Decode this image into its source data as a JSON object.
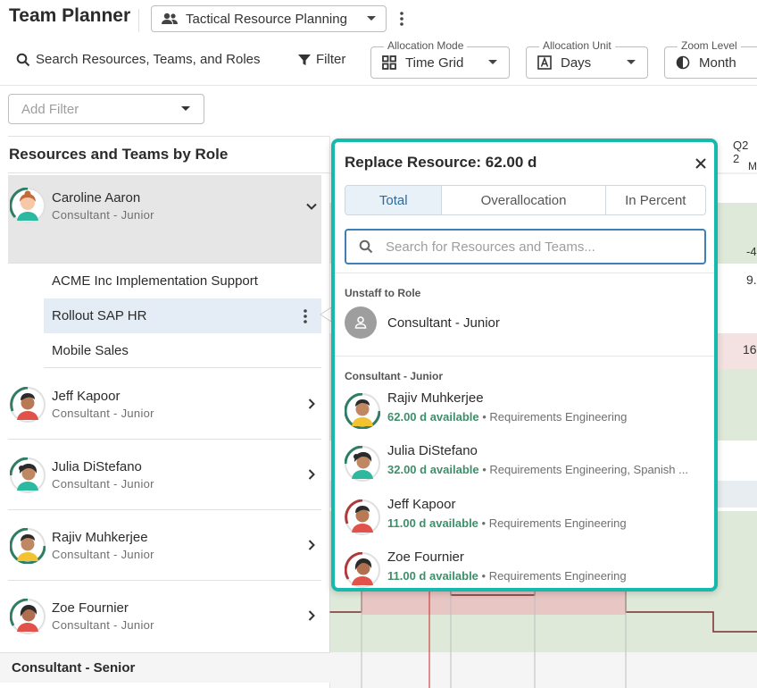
{
  "header": {
    "app_title": "Team Planner",
    "planner_select": "Tactical Resource Planning"
  },
  "toolbar": {
    "search_label": "Search Resources, Teams, and Roles",
    "filter_label": "Filter",
    "allocation_mode": {
      "caption": "Allocation Mode",
      "value": "Time Grid"
    },
    "allocation_unit": {
      "caption": "Allocation Unit",
      "value": "Days"
    },
    "zoom_level": {
      "caption": "Zoom Level",
      "value": "Month"
    },
    "add_filter_placeholder": "Add Filter"
  },
  "list": {
    "header": "Resources and Teams by Role",
    "resources": [
      {
        "name": "Caroline Aaron",
        "role": "Consultant - Junior"
      },
      {
        "name": "Jeff Kapoor",
        "role": "Consultant - Junior"
      },
      {
        "name": "Julia DiStefano",
        "role": "Consultant - Junior"
      },
      {
        "name": "Rajiv Muhkerjee",
        "role": "Consultant - Junior"
      },
      {
        "name": "Zoe Fournier",
        "role": "Consultant - Junior"
      }
    ],
    "projects": [
      "ACME Inc Implementation Support",
      "Rollout SAP HR",
      "Mobile Sales"
    ],
    "next_category": "Consultant - Senior"
  },
  "timeline": {
    "quarter_label": "Q2 2",
    "month_label": "M",
    "cells": {
      "neg4": "-4",
      "nine": "9.",
      "sixteen": "16"
    }
  },
  "popover": {
    "title": "Replace Resource: 62.00 d",
    "tabs": [
      "Total",
      "Overallocation",
      "In Percent"
    ],
    "active_tab": "Total",
    "search_placeholder": "Search for Resources and Teams...",
    "unstaff_label": "Unstaff to Role",
    "unstaff_role": "Consultant - Junior",
    "candidates_label": "Consultant - Junior",
    "candidates": [
      {
        "name": "Rajiv Muhkerjee",
        "available": "62.00 d available",
        "skills": "Requirements Engineering"
      },
      {
        "name": "Julia DiStefano",
        "available": "32.00 d available",
        "skills": "Requirements Engineering, Spanish ..."
      },
      {
        "name": "Jeff Kapoor",
        "available": "11.00 d available",
        "skills": "Requirements Engineering"
      },
      {
        "name": "Zoe Fournier",
        "available": "11.00 d available",
        "skills": "Requirements Engineering"
      }
    ]
  },
  "colors": {
    "accent": "#16b9ad",
    "available_green": "#3e8e6a",
    "over_red": "#e8c6c4",
    "under_green": "#dfe9d9",
    "selected_row": "#e4edf5"
  }
}
